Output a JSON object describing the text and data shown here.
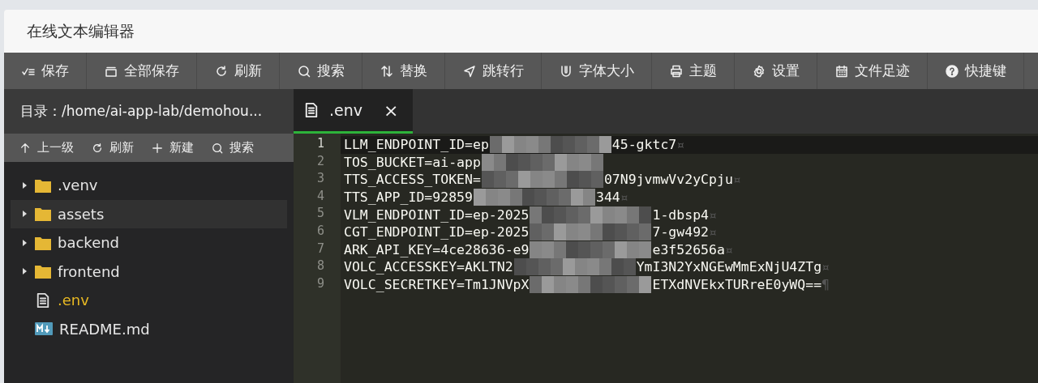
{
  "window": {
    "title": "在线文本编辑器"
  },
  "toolbar": [
    {
      "label": "保存"
    },
    {
      "label": "全部保存"
    },
    {
      "label": "刷新"
    },
    {
      "label": "搜索"
    },
    {
      "label": "替换"
    },
    {
      "label": "跳转行"
    },
    {
      "label": "字体大小"
    },
    {
      "label": "主题"
    },
    {
      "label": "设置"
    },
    {
      "label": "文件足迹"
    },
    {
      "label": "快捷键"
    }
  ],
  "sidebar": {
    "path": "目录：/home/ai-app-lab/demohou...",
    "actions": [
      {
        "label": "上一级"
      },
      {
        "label": "刷新"
      },
      {
        "label": "新建"
      },
      {
        "label": "搜索"
      }
    ],
    "items": [
      {
        "kind": "folder",
        "name": ".venv",
        "expanded": false,
        "selected": false,
        "hovered": false
      },
      {
        "kind": "folder",
        "name": "assets",
        "expanded": false,
        "selected": false,
        "hovered": true
      },
      {
        "kind": "folder",
        "name": "backend",
        "expanded": false,
        "selected": false,
        "hovered": false
      },
      {
        "kind": "folder",
        "name": "frontend",
        "expanded": false,
        "selected": false,
        "hovered": false
      },
      {
        "kind": "file",
        "name": ".env",
        "selected": true,
        "hovered": false
      },
      {
        "kind": "markdown",
        "name": "README.md",
        "selected": false,
        "hovered": false
      }
    ]
  },
  "tabs": [
    {
      "label": ".env",
      "close": "×",
      "selected": true
    }
  ],
  "editor": {
    "lines": [
      {
        "number": "1",
        "before": "LLM_ENDPOINT_ID=ep",
        "redacted": true,
        "after": "45-gktc7",
        "eol": "¤",
        "current": true
      },
      {
        "number": "2",
        "before": "TOS_BUCKET=ai-app",
        "redacted": true,
        "current": false
      },
      {
        "number": "3",
        "before": "TTS_ACCESS_TOKEN=",
        "redacted": true,
        "after": "07N9jvmwVv2yCpju",
        "eol": "¤",
        "current": false
      },
      {
        "number": "4",
        "before": "TTS_APP_ID=92859",
        "redacted": true,
        "after": "344",
        "eol": "¤",
        "current": false
      },
      {
        "number": "5",
        "before": "VLM_ENDPOINT_ID=ep-2025",
        "redacted": true,
        "after": "1-dbsp4",
        "eol": "¤",
        "current": false
      },
      {
        "number": "6",
        "before": "CGT_ENDPOINT_ID=ep-2025",
        "redacted": true,
        "after": "7-gw492",
        "eol": "¤",
        "current": false
      },
      {
        "number": "7",
        "before": "ARK_API_KEY=4ce28636-e9",
        "redacted": true,
        "after": "e3f52656a",
        "eol": "¤",
        "current": false
      },
      {
        "number": "8",
        "before": "VOLC_ACCESSKEY=AKLTN2",
        "redacted": true,
        "after": "YmI3N2YxNGEwMmExNjU4ZTg",
        "eol": "¤",
        "current": false
      },
      {
        "number": "9",
        "before": "VOLC_SECRETKEY=Tm1JNVpX",
        "redacted": true,
        "after": "ETXdNVEkxTURreE0yWQ==",
        "eol": "¶",
        "current": false
      }
    ]
  }
}
